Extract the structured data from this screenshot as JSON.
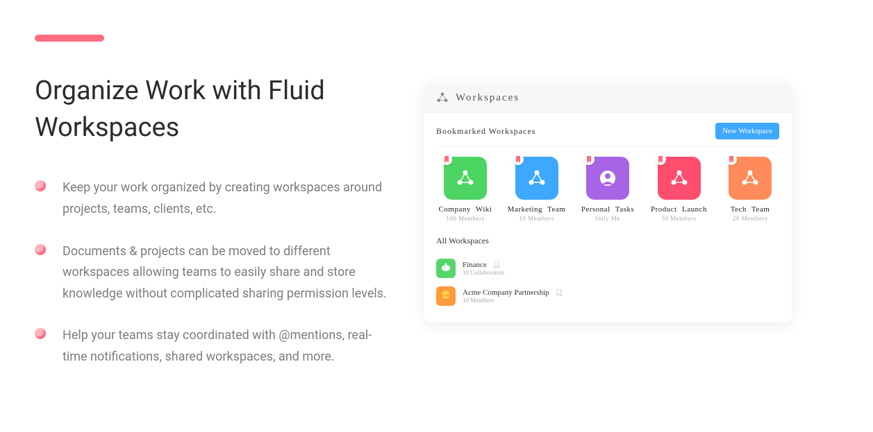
{
  "accent_color": "#ff6b81",
  "headline": "Organize Work with Fluid Workspaces",
  "bullets": [
    "Keep your work organized by creating workspaces around projects, teams, clients, etc.",
    "Documents & projects can be moved to different workspaces allowing teams to easily share and store knowledge without complicated sharing permission levels.",
    "Help your teams stay coordinated with @mentions, real-time notifications, shared workspaces, and more."
  ],
  "app": {
    "header_title": "Workspaces",
    "bookmarked_label": "Bookmarked   Workspaces",
    "new_button": "New Workspace",
    "bookmarked": [
      {
        "name": "Company Wiki",
        "meta": "100 Members",
        "icon": "share",
        "color": "c-green"
      },
      {
        "name": "Marketing  Team",
        "meta": "10 Members",
        "icon": "share",
        "color": "c-blue"
      },
      {
        "name": "Personal  Tasks",
        "meta": "Only Me",
        "icon": "avatar",
        "color": "c-purple"
      },
      {
        "name": "Product Launch",
        "meta": "50 Members",
        "icon": "share",
        "color": "c-red"
      },
      {
        "name": "Tech  Team",
        "meta": "20 Members",
        "icon": "share",
        "color": "c-orange"
      }
    ],
    "all_label": "All Workspaces",
    "all": [
      {
        "name": "Finance",
        "meta": "10 Collaborators",
        "icon": "piggy",
        "color": "c-sm-green"
      },
      {
        "name": "Acme Company Partnership",
        "meta": "10 Members",
        "icon": "acme",
        "color": "c-sm-orange"
      }
    ]
  }
}
